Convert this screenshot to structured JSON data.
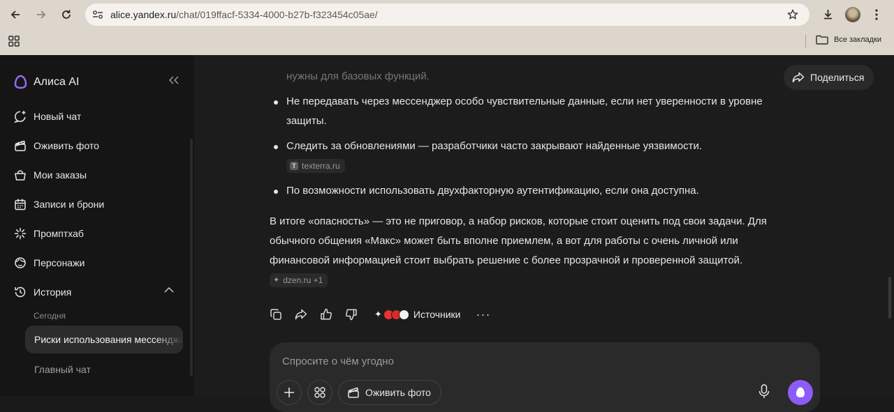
{
  "browser": {
    "url_host": "alice.yandex.ru",
    "url_path": "/chat/019ffacf-5334-4000-b27b-f323454c05ae/",
    "bookmarks_all": "Все закладки"
  },
  "sidebar": {
    "brand": "Алиса AI",
    "items": [
      {
        "label": "Новый чат",
        "icon": "new-chat-icon"
      },
      {
        "label": "Оживить фото",
        "icon": "clapper-icon"
      },
      {
        "label": "Мои заказы",
        "icon": "basket-icon"
      },
      {
        "label": "Записи и брони",
        "icon": "calendar-icon"
      },
      {
        "label": "Промптхаб",
        "icon": "sparkle-burst-icon"
      },
      {
        "label": "Персонажи",
        "icon": "face-icon"
      },
      {
        "label": "История",
        "icon": "history-icon"
      }
    ],
    "history_group": "Сегодня",
    "chats": [
      "Риски использования мессенджера Макс",
      "Главный чат"
    ]
  },
  "main": {
    "share_label": "Поделиться",
    "faded_line": "нужны для базовых функций.",
    "bullets": [
      {
        "text": "Не передавать через мессенджер особо чувствительные данные, если нет уверенности в уровне защиты."
      },
      {
        "text": "Следить за обновлениями — разработчики часто закрывают найденные уязвимости.",
        "chip": "texterra.ru"
      },
      {
        "text": "По возможности использовать двухфакторную аутентификацию, если она доступна."
      }
    ],
    "conclusion": "В итоге «опасность» — это не приговор, а набор рисков, которые стоит оценить под свои задачи. Для обычного общения «Макс» может быть вполне приемлем, а вот для работы с очень личной или финансовой информацией стоит выбрать решение с более прозрачной и проверенной защитой.",
    "conclusion_chip": "dzen.ru +1",
    "sources_label": "Источники",
    "more_label": "···",
    "composer": {
      "placeholder": "Спросите о чём угодно",
      "animate_photo": "Оживить фото"
    }
  },
  "colors": {
    "accent": "#8c5cf6",
    "sidebar_bg": "#151515",
    "main_bg": "#1c1c1c",
    "chrome_bg": "#dcd6cc"
  }
}
